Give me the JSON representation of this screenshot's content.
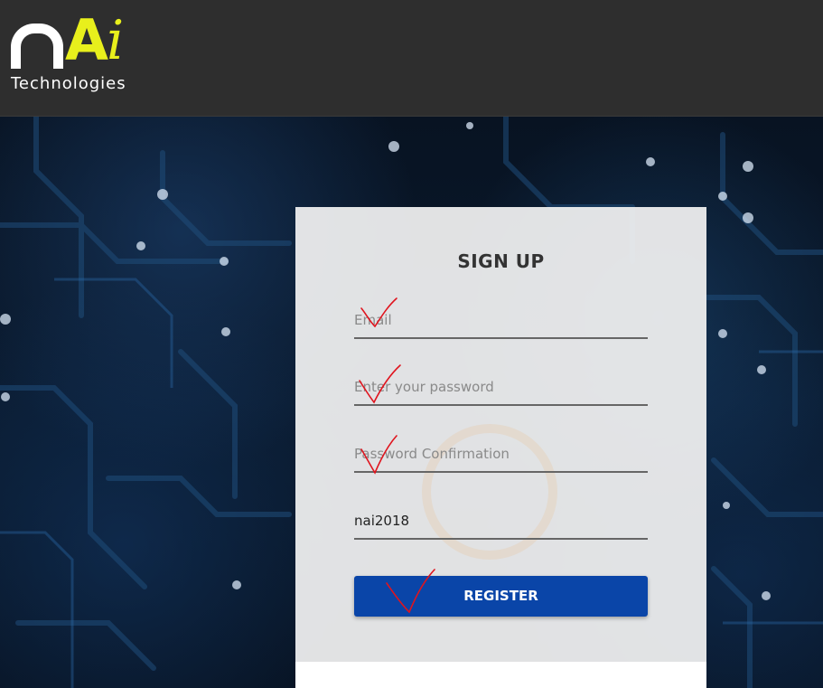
{
  "header": {
    "logo_letters_a": "A",
    "logo_letters_i": "i",
    "logo_subtitle": "Technologies"
  },
  "signup": {
    "title": "SIGN UP",
    "email": {
      "placeholder": "Email",
      "value": ""
    },
    "password": {
      "placeholder": "Enter your password",
      "value": ""
    },
    "password_confirmation": {
      "placeholder": "Password Confirmation",
      "value": ""
    },
    "code": {
      "placeholder": "",
      "value": "nai2018"
    },
    "register_label": "REGISTER"
  },
  "colors": {
    "header_bg": "#2e2e2e",
    "logo_accent": "#e8ef1c",
    "button_bg": "#0a45a8",
    "checkmark": "#e0141e"
  },
  "annotations": {
    "checkmark_icon": "red-checkmark"
  }
}
